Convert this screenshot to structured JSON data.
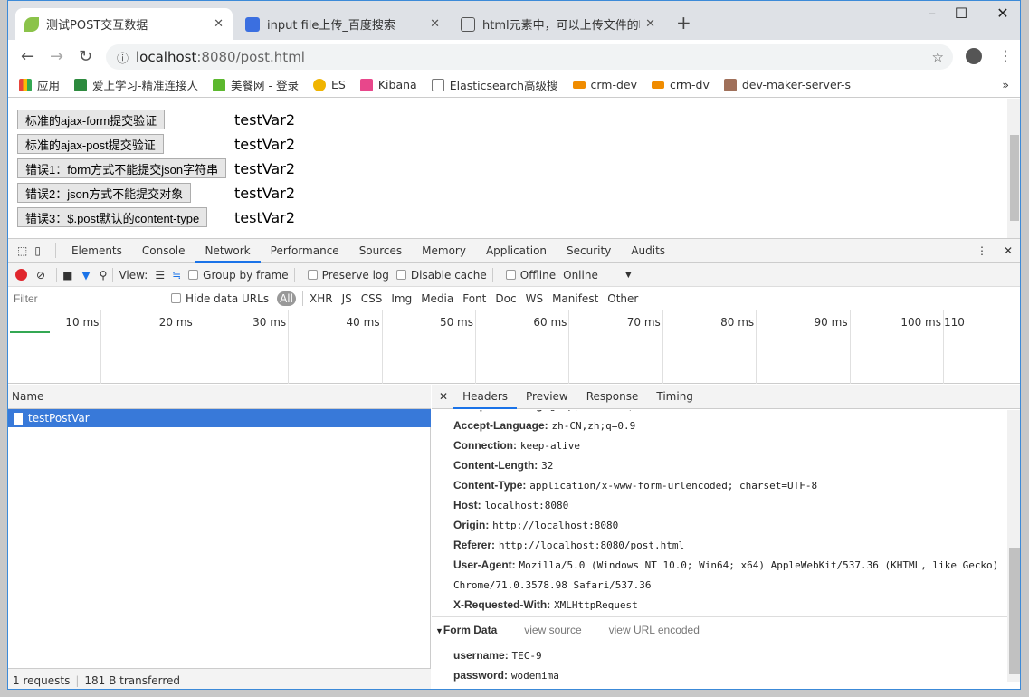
{
  "browser": {
    "tabs": [
      {
        "title": "测试POST交互数据",
        "icon": "leaf-icon",
        "active": true
      },
      {
        "title": "input file上传_百度搜索",
        "icon": "baidu-paw-icon"
      },
      {
        "title": "html元素中，可以上传文件的唯一",
        "icon": "ping-icon"
      }
    ],
    "url_host": "localhost",
    "url_rest": ":8080/post.html",
    "bookmarks": [
      {
        "label": "应用",
        "color": "#e8453c"
      },
      {
        "label": "爱上学习-精准连接人",
        "color": "#2d8a3e"
      },
      {
        "label": "美餐网 - 登录",
        "color": "#5cb82e"
      },
      {
        "label": "ES",
        "color": "#f0b400"
      },
      {
        "label": "Kibana",
        "color": "#e8478b"
      },
      {
        "label": "Elasticsearch高级搜",
        "color": "#777777"
      },
      {
        "label": "crm-dev",
        "color": "#f08c00"
      },
      {
        "label": "crm-dv",
        "color": "#f08c00"
      },
      {
        "label": "dev-maker-server-s",
        "color": "#a0705a"
      }
    ],
    "more": "»"
  },
  "page": {
    "rows": [
      {
        "button": "标准的ajax-form提交验证",
        "value": "testVar2"
      },
      {
        "button": "标准的ajax-post提交验证",
        "value": "testVar2"
      },
      {
        "button": "错误1：form方式不能提交json字符串",
        "value": "testVar2"
      },
      {
        "button": "错误2：json方式不能提交对象",
        "value": "testVar2"
      },
      {
        "button": "错误3：$.post默认的content-type",
        "value": "testVar2"
      }
    ]
  },
  "devtools": {
    "tabs": [
      "Elements",
      "Console",
      "Network",
      "Performance",
      "Sources",
      "Memory",
      "Application",
      "Security",
      "Audits"
    ],
    "selected_tab": "Network",
    "toolbar": {
      "view": "View:",
      "group_by_frame": "Group by frame",
      "preserve_log": "Preserve log",
      "disable_cache": "Disable cache",
      "offline": "Offline",
      "throttle": "Online"
    },
    "filter": {
      "placeholder": "Filter",
      "hide_data_urls": "Hide data URLs",
      "types": [
        "All",
        "XHR",
        "JS",
        "CSS",
        "Img",
        "Media",
        "Font",
        "Doc",
        "WS",
        "Manifest",
        "Other"
      ]
    },
    "timeline_ticks": [
      "10 ms",
      "20 ms",
      "30 ms",
      "40 ms",
      "50 ms",
      "60 ms",
      "70 ms",
      "80 ms",
      "90 ms",
      "100 ms",
      "110"
    ],
    "name_header": "Name",
    "requests": [
      {
        "name": "testPostVar"
      }
    ],
    "footer": {
      "requests": "1 requests",
      "transferred": "181 B transferred"
    },
    "detail_tabs": [
      "Headers",
      "Preview",
      "Response",
      "Timing"
    ],
    "headers": [
      {
        "k": "Accept-Encoding:",
        "v": "gzip, deflate, br"
      },
      {
        "k": "Accept-Language:",
        "v": "zh-CN,zh;q=0.9"
      },
      {
        "k": "Connection:",
        "v": "keep-alive"
      },
      {
        "k": "Content-Length:",
        "v": "32"
      },
      {
        "k": "Content-Type:",
        "v": "application/x-www-form-urlencoded; charset=UTF-8"
      },
      {
        "k": "Host:",
        "v": "localhost:8080"
      },
      {
        "k": "Origin:",
        "v": "http://localhost:8080"
      },
      {
        "k": "Referer:",
        "v": "http://localhost:8080/post.html"
      },
      {
        "k": "User-Agent:",
        "v": "Mozilla/5.0 (Windows NT 10.0; Win64; x64) AppleWebKit/537.36 (KHTML, like Gecko)"
      },
      {
        "k": "",
        "v": "Chrome/71.0.3578.98 Safari/537.36"
      },
      {
        "k": "X-Requested-With:",
        "v": "XMLHttpRequest"
      }
    ],
    "form_data": {
      "title": "Form Data",
      "view_source": "view source",
      "view_url_encoded": "view URL encoded",
      "fields": [
        {
          "k": "username:",
          "v": "TEC-9"
        },
        {
          "k": "password:",
          "v": "wodemima"
        }
      ]
    }
  }
}
